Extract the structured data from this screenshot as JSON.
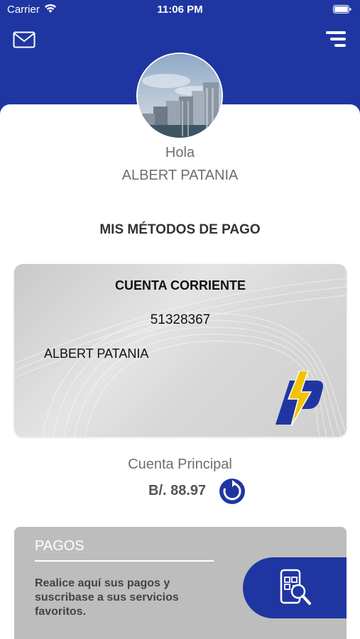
{
  "status_bar": {
    "carrier": "Carrier",
    "time": "11:06 PM"
  },
  "icons": {
    "mail": "mail-icon",
    "menu": "menu-icon",
    "refresh": "refresh-icon",
    "qr_phone": "qr-phone-icon",
    "brand_logo": "bolt-p-logo"
  },
  "profile": {
    "greeting": "Hola",
    "name": "ALBERT PATANIA"
  },
  "section_title": "MIS MÉTODOS DE PAGO",
  "card": {
    "type": "CUENTA CORRIENTE",
    "number": "51328367",
    "holder": "ALBERT PATANIA"
  },
  "account": {
    "label": "Cuenta Principal",
    "balance": "B/. 88.97"
  },
  "payments": {
    "title": "PAGOS",
    "description": "Realice aquí sus pagos y suscribase a sus servicios favoritos."
  },
  "colors": {
    "primary": "#1f36a2",
    "accent": "#f2c400",
    "card_bg": "#d8d8d8",
    "payments_bg": "#bdbdbd"
  }
}
